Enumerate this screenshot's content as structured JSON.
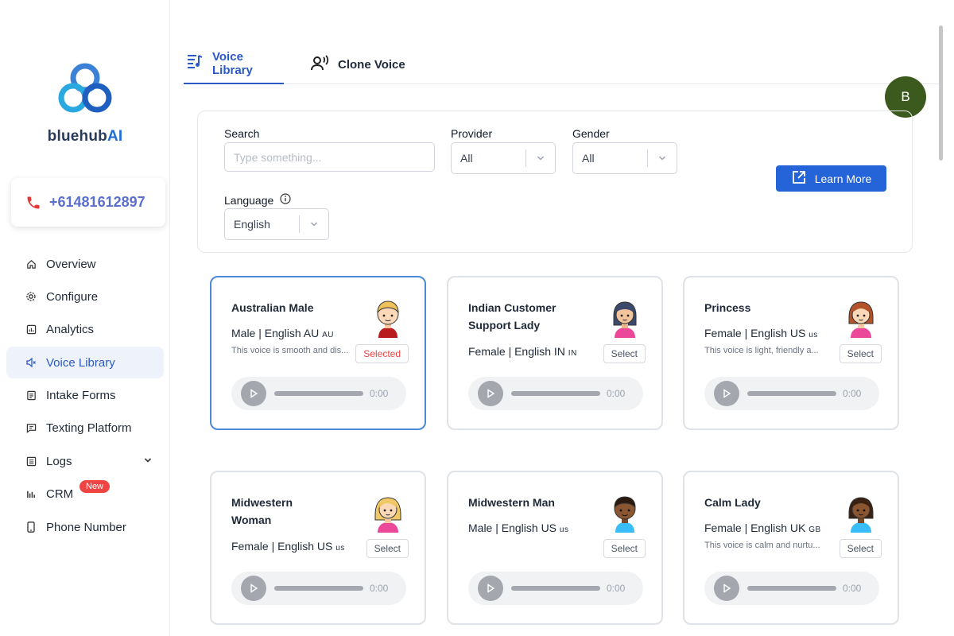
{
  "brand": {
    "name_prefix": "bluehub",
    "name_suffix": "AI"
  },
  "phone": {
    "number": "+61481612897"
  },
  "sidebar": {
    "items": [
      {
        "label": "Overview",
        "icon": "home-icon"
      },
      {
        "label": "Configure",
        "icon": "gear-icon"
      },
      {
        "label": "Analytics",
        "icon": "chart-icon"
      },
      {
        "label": "Voice Library",
        "icon": "speaker-icon",
        "active": true
      },
      {
        "label": "Intake Forms",
        "icon": "form-icon"
      },
      {
        "label": "Texting Platform",
        "icon": "chat-icon"
      },
      {
        "label": "Logs",
        "icon": "log-icon"
      },
      {
        "label": "CRM",
        "icon": "crm-icon"
      },
      {
        "label": "Phone Number",
        "icon": "phone-device-icon"
      }
    ],
    "crm_badge": "New"
  },
  "tabs": {
    "voice_library": "Voice Library",
    "clone_voice": "Clone Voice"
  },
  "user": {
    "initial": "B",
    "color": "#3d5a1e"
  },
  "filters": {
    "search_label": "Search",
    "search_placeholder": "Type something...",
    "provider_label": "Provider",
    "provider_value": "All",
    "gender_label": "Gender",
    "gender_value": "All",
    "language_label": "Language",
    "language_value": "English",
    "learn_more": "Learn More"
  },
  "colors": {
    "accent": "#2563d9",
    "active_text": "#2b59c3",
    "selected_red": "#ef4444"
  },
  "voices": [
    {
      "name": "Australian Male",
      "meta": "Male | English AU",
      "code": "AU",
      "desc": "This voice is smooth and dis...",
      "button": "Selected",
      "time": "0:00"
    },
    {
      "name": "Indian Customer Support Lady",
      "meta": "Female | English IN",
      "code": "IN",
      "desc": "",
      "button": "Select",
      "time": "0:00"
    },
    {
      "name": "Princess",
      "meta": "Female | English US",
      "code": "us",
      "desc": "This voice is light, friendly a...",
      "button": "Select",
      "time": "0:00"
    },
    {
      "name": "Midwestern Woman",
      "meta": "Female | English US",
      "code": "us",
      "desc": "",
      "button": "Select",
      "time": "0:00"
    },
    {
      "name": "Midwestern Man",
      "meta": "Male | English US",
      "code": "us",
      "desc": "",
      "button": "Select",
      "time": "0:00"
    },
    {
      "name": "Calm Lady",
      "meta": "Female | English UK",
      "code": "GB",
      "desc": "This voice is calm and nurtu...",
      "button": "Select",
      "time": "0:00"
    }
  ]
}
